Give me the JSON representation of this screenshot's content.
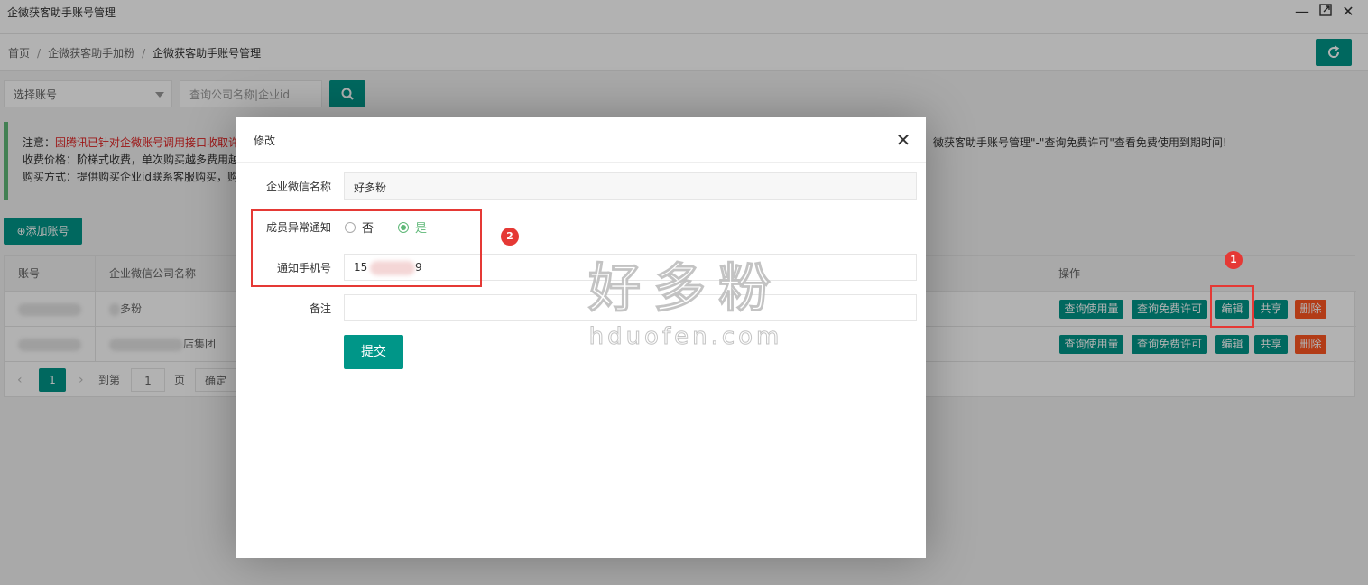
{
  "window": {
    "title": "企微获客助手账号管理"
  },
  "breadcrumb": [
    "首页",
    "企微获客助手加粉",
    "企微获客助手账号管理"
  ],
  "filters": {
    "account_select": "选择账号",
    "search_placeholder": "查询公司名称|企业id"
  },
  "notice": {
    "line1_label": "注意：",
    "line1_text": "因腾讯已针对企微账号调用接口收取许",
    "line1_tail": "微获客助手账号管理\"-\"查询免费许可\"查看免费使用到期时间!",
    "line2": "收费价格：阶梯式收费，单次购买越多费用越",
    "line3": "购买方式：提供购买企业id联系客服购买，购"
  },
  "add_button": "⊕添加账号",
  "table": {
    "headers": {
      "account": "账号",
      "company": "企业微信公司名称",
      "actions": "操作"
    },
    "rows": [
      {
        "company": "多粉"
      },
      {
        "company": "店集团"
      }
    ],
    "actions": {
      "usage": "查询使用量",
      "license": "查询免费许可",
      "edit": "编辑",
      "share": "共享",
      "delete": "删除"
    }
  },
  "pager": {
    "current": "1",
    "goto_label": "到第",
    "page_input": "1",
    "page_suffix": "页",
    "confirm": "确定"
  },
  "modal": {
    "title": "修改",
    "fields": {
      "name_label": "企业微信名称",
      "name_value": "好多粉",
      "notify_label": "成员异常通知",
      "option_no": "否",
      "option_yes": "是",
      "phone_label": "通知手机号",
      "phone_prefix": "15",
      "phone_suffix": "9",
      "remark_label": "备注",
      "remark_value": ""
    },
    "submit": "提交"
  },
  "watermark": {
    "cn": "好多粉",
    "en": "hduofen.com"
  },
  "markers": [
    "1",
    "2"
  ],
  "colors": {
    "primary": "#009688",
    "danger": "#ff5722",
    "radio_on": "#5fb878",
    "highlight": "#e53935"
  }
}
